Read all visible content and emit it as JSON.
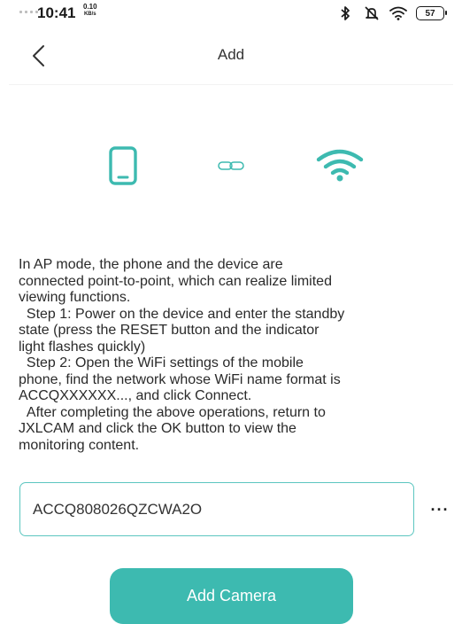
{
  "status_bar": {
    "time": "10:41",
    "net_speed_value": "0.10",
    "net_speed_unit": "KB/s",
    "battery": "57",
    "icons": [
      "bluetooth-icon",
      "mute-icon",
      "wifi-icon",
      "battery-icon"
    ]
  },
  "header": {
    "title": "Add",
    "back_icon": "chevron-left-icon"
  },
  "illustration": {
    "icons": [
      "phone-icon",
      "link-icon",
      "wifi-icon"
    ],
    "accent_color": "#3dbab0"
  },
  "instructions": {
    "text": "In AP mode, the phone and the device are\nconnected point-to-point, which can realize limited\nviewing functions.\n  Step 1: Power on the device and enter the standby\nstate (press the RESET button and the indicator\nlight flashes quickly)\n  Step 2: Open the WiFi settings of the mobile\nphone, find the network whose WiFi name format is\nACCQXXXXXX..., and click Connect.\n  After completing the above operations, return to\nJXLCAM and click the OK button to view the\nmonitoring content."
  },
  "ssid_input": {
    "value": "ACCQ808026QZCWA2O",
    "border_color": "#5cc6c0"
  },
  "more_button": {
    "label": "···"
  },
  "add_camera_button": {
    "label": "Add Camera",
    "color": "#3dbab0"
  }
}
